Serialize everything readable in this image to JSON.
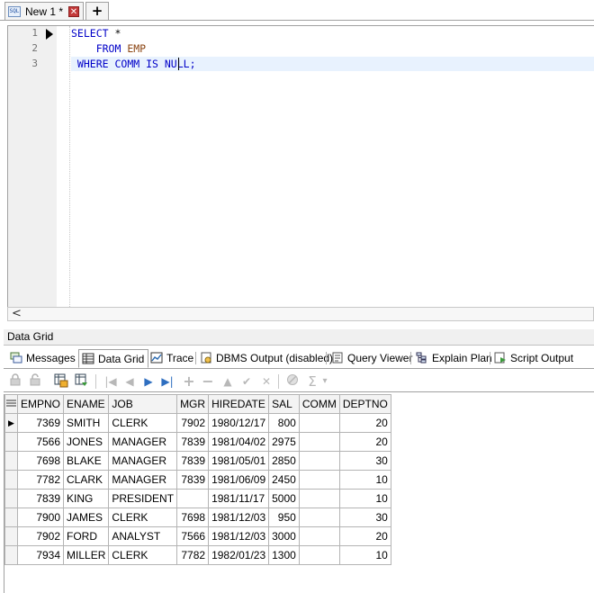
{
  "doc_tab": {
    "icon_text": "SQL",
    "label": "New 1 *",
    "close": "✕",
    "add": "+"
  },
  "editor": {
    "line_numbers": [
      "1",
      "2",
      "3"
    ],
    "lines": [
      {
        "kw1": "SELECT",
        "rest": " *"
      },
      {
        "indent": "    ",
        "kw1": "FROM",
        "table": " EMP"
      },
      {
        "kw1": " WHERE",
        "rest2": " COMM ",
        "kw2": "IS",
        "rest3": " NULL;"
      }
    ],
    "scroll_left": "<"
  },
  "panel": {
    "title": "Data Grid"
  },
  "result_tabs": [
    "Messages",
    "Data Grid",
    "Trace",
    "DBMS Output (disabled)",
    "Query Viewer",
    "Explain Plan",
    "Script Output"
  ],
  "toolbar": {
    "first": "|◀",
    "prev": "◀",
    "next": "▶",
    "last": "▶|",
    "add": "+",
    "remove": "−",
    "up": "▲",
    "apply": "✔",
    "cancel": "✕",
    "sum": "Σ",
    "dropdown": "▾"
  },
  "grid": {
    "columns": [
      "EMPNO",
      "ENAME",
      "JOB",
      "MGR",
      "HIREDATE",
      "SAL",
      "COMM",
      "DEPTNO"
    ],
    "current_row_marker": "▶",
    "rows": [
      [
        "7369",
        "SMITH",
        "CLERK",
        "7902",
        "1980/12/17",
        "800",
        "",
        "20"
      ],
      [
        "7566",
        "JONES",
        "MANAGER",
        "7839",
        "1981/04/02",
        "2975",
        "",
        "20"
      ],
      [
        "7698",
        "BLAKE",
        "MANAGER",
        "7839",
        "1981/05/01",
        "2850",
        "",
        "30"
      ],
      [
        "7782",
        "CLARK",
        "MANAGER",
        "7839",
        "1981/06/09",
        "2450",
        "",
        "10"
      ],
      [
        "7839",
        "KING",
        "PRESIDENT",
        "",
        "1981/11/17",
        "5000",
        "",
        "10"
      ],
      [
        "7900",
        "JAMES",
        "CLERK",
        "7698",
        "1981/12/03",
        "950",
        "",
        "30"
      ],
      [
        "7902",
        "FORD",
        "ANALYST",
        "7566",
        "1981/12/03",
        "3000",
        "",
        "20"
      ],
      [
        "7934",
        "MILLER",
        "CLERK",
        "7782",
        "1982/01/23",
        "1300",
        "",
        "10"
      ]
    ]
  }
}
